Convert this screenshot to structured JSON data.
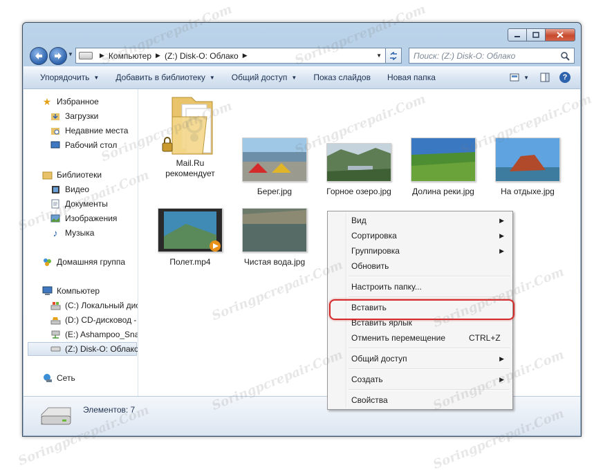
{
  "window": {
    "address": {
      "segments": [
        "Компьютер",
        "(Z:) Disk-O: Облако"
      ],
      "search_placeholder": "Поиск: (Z:) Disk-O: Облако"
    },
    "toolbar": {
      "organize": "Упорядочить",
      "add_library": "Добавить в библиотеку",
      "share": "Общий доступ",
      "slideshow": "Показ слайдов",
      "new_folder": "Новая папка"
    },
    "nav": {
      "favorites": "Избранное",
      "downloads": "Загрузки",
      "recent": "Недавние места",
      "desktop": "Рабочий стол",
      "libraries": "Библиотеки",
      "video": "Видео",
      "documents": "Документы",
      "images": "Изображения",
      "music": "Музыка",
      "homegroup": "Домашняя группа",
      "computer": "Компьютер",
      "drive_c": "(C:) Локальный дис",
      "drive_d": "(D:) CD-дисковод - `",
      "drive_e": "(E:) Ashampoo_Snap",
      "drive_z": "(Z:) Disk-O: Облако",
      "network": "Сеть"
    },
    "files": [
      {
        "name": "Mail.Ru рекомендует",
        "type": "folder"
      },
      {
        "name": "Берег.jpg",
        "type": "image"
      },
      {
        "name": "Горное озеро.jpg",
        "type": "image"
      },
      {
        "name": "Долина реки.jpg",
        "type": "image"
      },
      {
        "name": "На отдыхе.jpg",
        "type": "image"
      },
      {
        "name": "Полет.mp4",
        "type": "video"
      },
      {
        "name": "Чистая вода.jpg",
        "type": "image"
      }
    ],
    "status": {
      "items_count": "Элементов: 7"
    }
  },
  "context_menu": {
    "view": "Вид",
    "sort": "Сортировка",
    "group": "Группировка",
    "refresh": "Обновить",
    "customize": "Настроить папку...",
    "paste": "Вставить",
    "paste_shortcut": "Вставить ярлык",
    "undo_move": "Отменить перемещение",
    "undo_shortcut": "CTRL+Z",
    "share": "Общий доступ",
    "create": "Создать",
    "properties": "Свойства"
  },
  "watermark": "Soringpcrepair.Com",
  "colors": {
    "highlight_border": "#d42a2a",
    "toolbar_text": "#1e3250",
    "accent_blue": "#2d63ad"
  }
}
